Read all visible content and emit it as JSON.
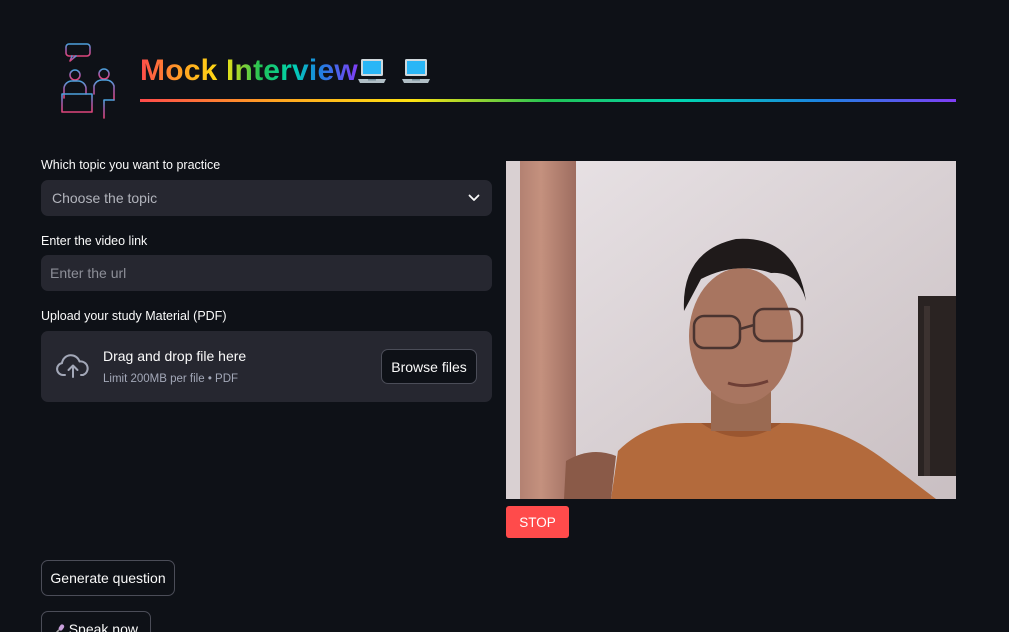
{
  "header": {
    "title": "Mock Interview",
    "title_emoji": [
      "laptop-emoji",
      "laptop-emoji"
    ],
    "gradient": [
      "#ff4b4b",
      "#ffa421",
      "#ffe312",
      "#21c354",
      "#00d4b1",
      "#1c83e1",
      "#803df5"
    ]
  },
  "topic": {
    "label": "Which topic you want to practice",
    "placeholder": "Choose the topic"
  },
  "video_link": {
    "label": "Enter the video link",
    "placeholder": "Enter the url",
    "value": ""
  },
  "upload": {
    "label": "Upload your study Material (PDF)",
    "drop_text": "Drag and drop file here",
    "limit_text": "Limit 200MB per file • PDF",
    "browse_label": "Browse files"
  },
  "webcam": {
    "stop_label": "STOP",
    "stop_color": "#ff4b4b"
  },
  "actions": {
    "generate_label": "Generate question",
    "speak_label": "Speak now",
    "speak_icon": "microphone-icon"
  },
  "theme": {
    "background": "#0e1117",
    "widget_bg": "#262730"
  }
}
